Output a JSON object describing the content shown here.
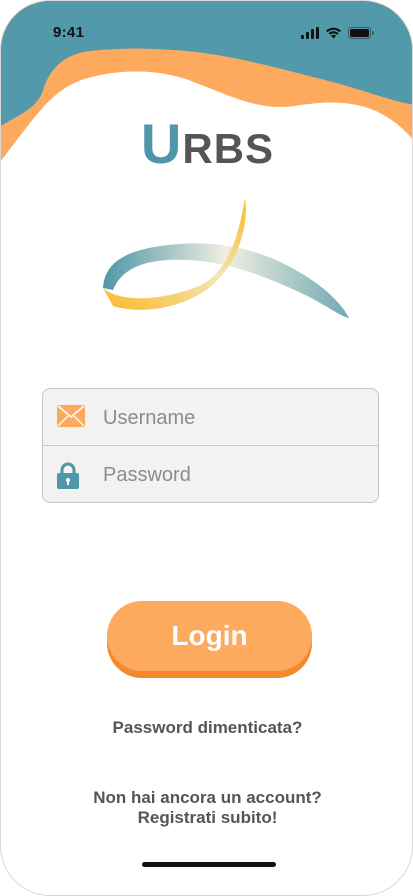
{
  "status_bar": {
    "time": "9:41"
  },
  "logo": {
    "first_letter": "U",
    "rest": "RBS"
  },
  "form": {
    "username_placeholder": "Username",
    "password_placeholder": "Password"
  },
  "login_button": "Login",
  "forgot_password": "Password dimenticata?",
  "register": {
    "line1": "Non hai ancora un account?",
    "line2": "Registrati subito!"
  },
  "colors": {
    "teal": "#4f97a8",
    "orange": "#fda95e",
    "orange_dark": "#f28a2c",
    "gold": "#fbb826"
  },
  "icons": [
    "mail-icon",
    "lock-icon",
    "signal-icon",
    "wifi-icon",
    "battery-icon"
  ]
}
